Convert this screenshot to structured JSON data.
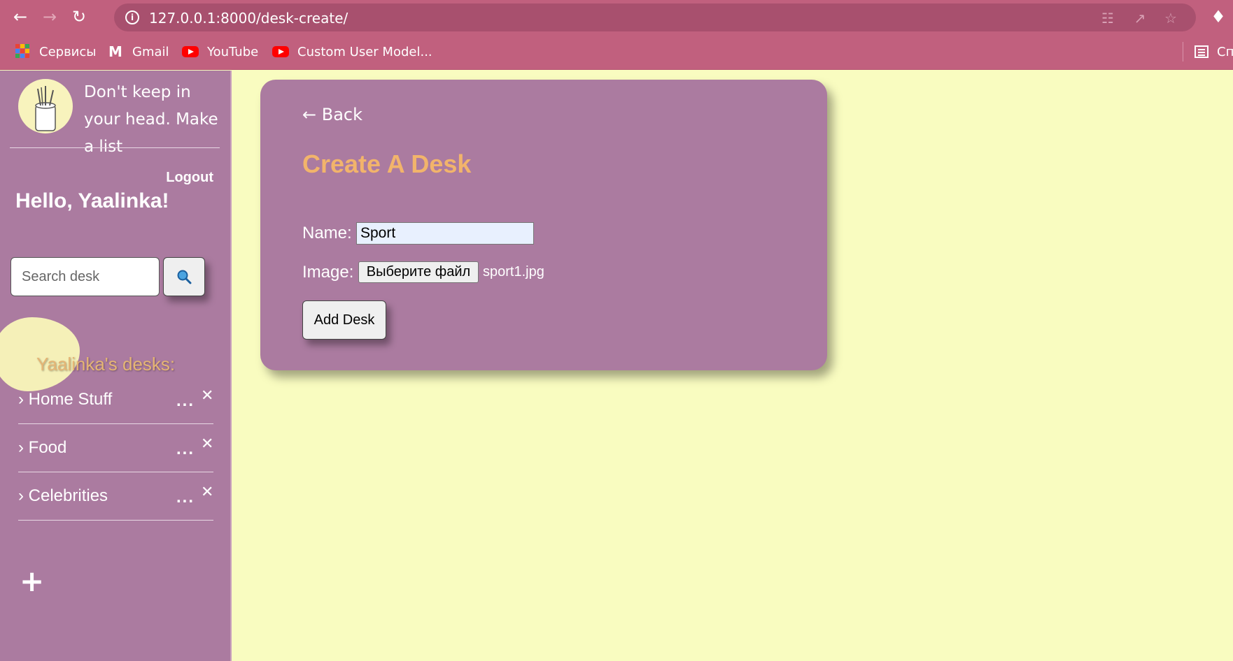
{
  "browser": {
    "url": "127.0.0.1:8000/desk-create/",
    "back_icon": "arrow-left",
    "forward_icon": "arrow-right",
    "reload_icon": "reload",
    "bookmarks": [
      {
        "label": "Сервисы",
        "icon": "apps-grid-icon"
      },
      {
        "label": "Gmail",
        "icon": "gmail-icon"
      },
      {
        "label": "YouTube",
        "icon": "youtube-icon"
      },
      {
        "label": "Custom User Model...",
        "icon": "youtube-icon"
      }
    ],
    "reading_list_label": "Сп",
    "colors": {
      "chrome": "#c1607e",
      "address_bar": "#a8506e"
    }
  },
  "sidebar": {
    "tagline": "Don't keep in your head. Make a list",
    "logout_label": "Logout",
    "greeting": "Hello, Yaalinka!",
    "search_placeholder": "Search desk",
    "search_button_icon": "magnifier-icon",
    "desks_heading": "Yaalinka's desks:",
    "desks": [
      {
        "label": "› Home Stuff",
        "more": "...",
        "close": "✕"
      },
      {
        "label": "› Food",
        "more": "...",
        "close": "✕"
      },
      {
        "label": "› Celebrities",
        "more": "...",
        "close": "✕"
      }
    ],
    "add_label": "+",
    "colors": {
      "background": "#ab7ba0",
      "accent": "#e5b574",
      "blob": "#f5f0b8"
    }
  },
  "main": {
    "back_label": "← Back",
    "title": "Create A Desk",
    "name_label": "Name:",
    "name_value": "Sport",
    "image_label": "Image:",
    "file_button_label": "Выберите файл",
    "file_name": "sport1.jpg",
    "submit_label": "Add Desk",
    "colors": {
      "page": "#f9fcc0",
      "card": "#ab7ba0",
      "title": "#f2b46b"
    }
  }
}
